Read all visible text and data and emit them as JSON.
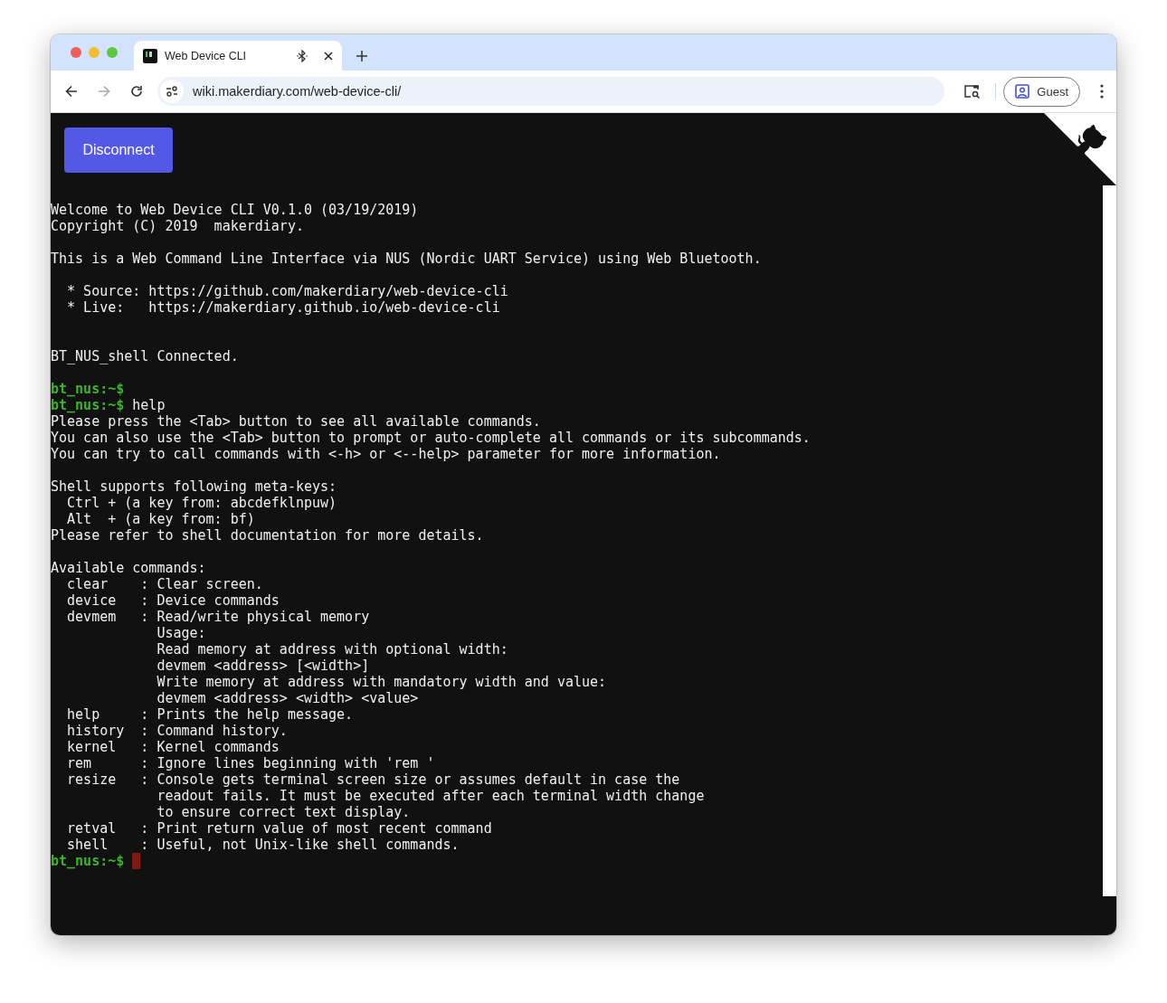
{
  "browser": {
    "tabs": [
      {
        "title": "Web Device CLI",
        "selected": true
      }
    ],
    "url": "wiki.makerdiary.com/web-device-cli/",
    "profile": "Guest",
    "forward_disabled": true
  },
  "button": {
    "label": "Disconnect"
  },
  "terminal": {
    "lines": [
      {
        "kind": "text",
        "text": "Welcome to Web Device CLI V0.1.0 (03/19/2019)"
      },
      {
        "kind": "text",
        "text": "Copyright (C) 2019  makerdiary."
      },
      {
        "kind": "blank"
      },
      {
        "kind": "text",
        "text": "This is a Web Command Line Interface via NUS (Nordic UART Service) using Web Bluetooth."
      },
      {
        "kind": "blank"
      },
      {
        "kind": "text",
        "text": "  * Source: https://github.com/makerdiary/web-device-cli"
      },
      {
        "kind": "text",
        "text": "  * Live:   https://makerdiary.github.io/web-device-cli"
      },
      {
        "kind": "blank"
      },
      {
        "kind": "blank"
      },
      {
        "kind": "text",
        "text": "BT_NUS_shell Connected."
      },
      {
        "kind": "blank"
      },
      {
        "kind": "prompt",
        "prompt": "bt_nus:~$",
        "cursor": false
      },
      {
        "kind": "prompt",
        "prompt": "bt_nus:~$",
        "command": "help",
        "cursor": false
      },
      {
        "kind": "text",
        "text": "Please press the <Tab> button to see all available commands."
      },
      {
        "kind": "text",
        "text": "You can also use the <Tab> button to prompt or auto-complete all commands or its subcommands."
      },
      {
        "kind": "text",
        "text": "You can try to call commands with <-h> or <--help> parameter for more information."
      },
      {
        "kind": "blank"
      },
      {
        "kind": "text",
        "text": "Shell supports following meta-keys:"
      },
      {
        "kind": "text",
        "text": "  Ctrl + (a key from: abcdefklnpuw)"
      },
      {
        "kind": "text",
        "text": "  Alt  + (a key from: bf)"
      },
      {
        "kind": "text",
        "text": "Please refer to shell documentation for more details."
      },
      {
        "kind": "blank"
      },
      {
        "kind": "text",
        "text": "Available commands:"
      },
      {
        "kind": "text",
        "text": "  clear    : Clear screen."
      },
      {
        "kind": "text",
        "text": "  device   : Device commands"
      },
      {
        "kind": "text",
        "text": "  devmem   : Read/write physical memory"
      },
      {
        "kind": "text",
        "text": "             Usage:"
      },
      {
        "kind": "text",
        "text": "             Read memory at address with optional width:"
      },
      {
        "kind": "text",
        "text": "             devmem <address> [<width>]"
      },
      {
        "kind": "text",
        "text": "             Write memory at address with mandatory width and value:"
      },
      {
        "kind": "text",
        "text": "             devmem <address> <width> <value>"
      },
      {
        "kind": "text",
        "text": "  help     : Prints the help message."
      },
      {
        "kind": "text",
        "text": "  history  : Command history."
      },
      {
        "kind": "text",
        "text": "  kernel   : Kernel commands"
      },
      {
        "kind": "text",
        "text": "  rem      : Ignore lines beginning with 'rem '"
      },
      {
        "kind": "text",
        "text": "  resize   : Console gets terminal screen size or assumes default in case the"
      },
      {
        "kind": "text",
        "text": "             readout fails. It must be executed after each terminal width change"
      },
      {
        "kind": "text",
        "text": "             to ensure correct text display."
      },
      {
        "kind": "text",
        "text": "  retval   : Print return value of most recent command"
      },
      {
        "kind": "text",
        "text": "  shell    : Useful, not Unix-like shell commands."
      },
      {
        "kind": "prompt",
        "prompt": "bt_nus:~$",
        "cursor": true
      }
    ]
  }
}
